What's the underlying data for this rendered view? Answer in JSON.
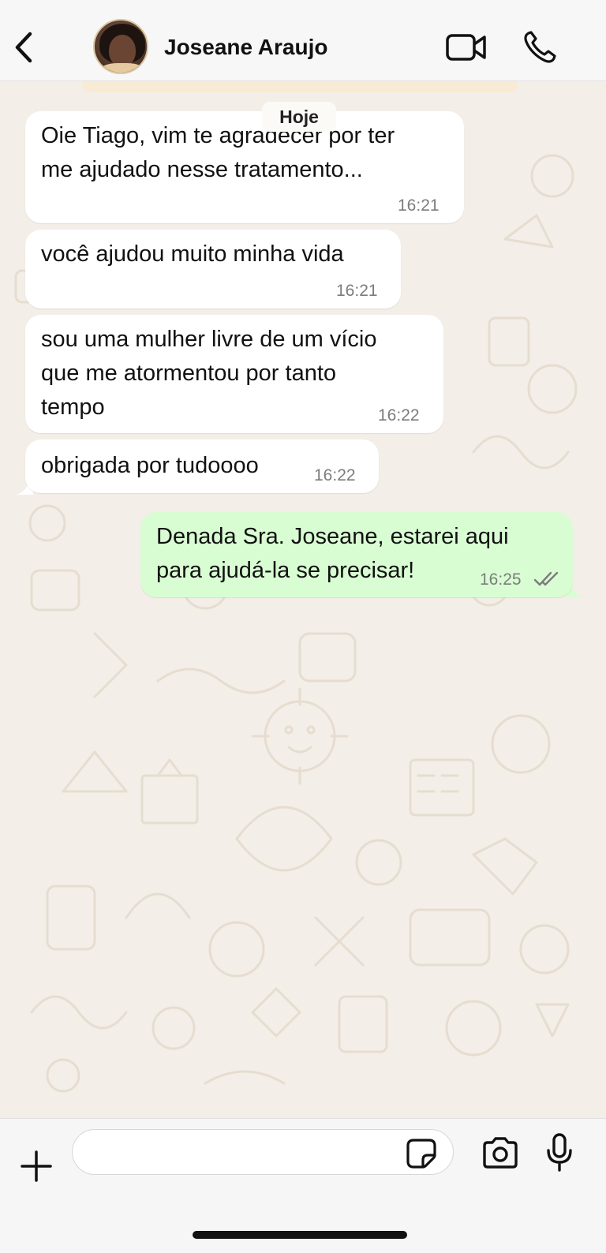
{
  "header": {
    "contact_name": "Joseane Araujo",
    "back_icon": "chevron-left-icon",
    "video_icon": "video-camera-icon",
    "call_icon": "phone-icon"
  },
  "chat": {
    "date_separator": "Hoje",
    "messages": [
      {
        "direction": "incoming",
        "text": "Oie Tiago, vim te agradecer por ter\nme ajudado nesse tratamento...",
        "time": "16:21"
      },
      {
        "direction": "incoming",
        "text": "você ajudou muito minha vida",
        "time": "16:21"
      },
      {
        "direction": "incoming",
        "text": "sou uma mulher livre de um vício\nque me atormentou por tanto\ntempo",
        "time": "16:22"
      },
      {
        "direction": "incoming",
        "text": "obrigada por tudoooo",
        "time": "16:22"
      },
      {
        "direction": "outgoing",
        "text": "Denada Sra. Joseane, estarei aqui\npara ajudá-la se precisar!",
        "time": "16:25",
        "status": "read"
      }
    ]
  },
  "composer": {
    "input_value": "",
    "plus_icon": "plus-icon",
    "sticker_icon": "sticker-icon",
    "camera_icon": "camera-icon",
    "mic_icon": "microphone-icon"
  },
  "colors": {
    "incoming_bubble": "#ffffff",
    "outgoing_bubble": "#d9fdd3",
    "wallpaper": "#f3eee7",
    "read_ticks": "#7c7c7c"
  }
}
